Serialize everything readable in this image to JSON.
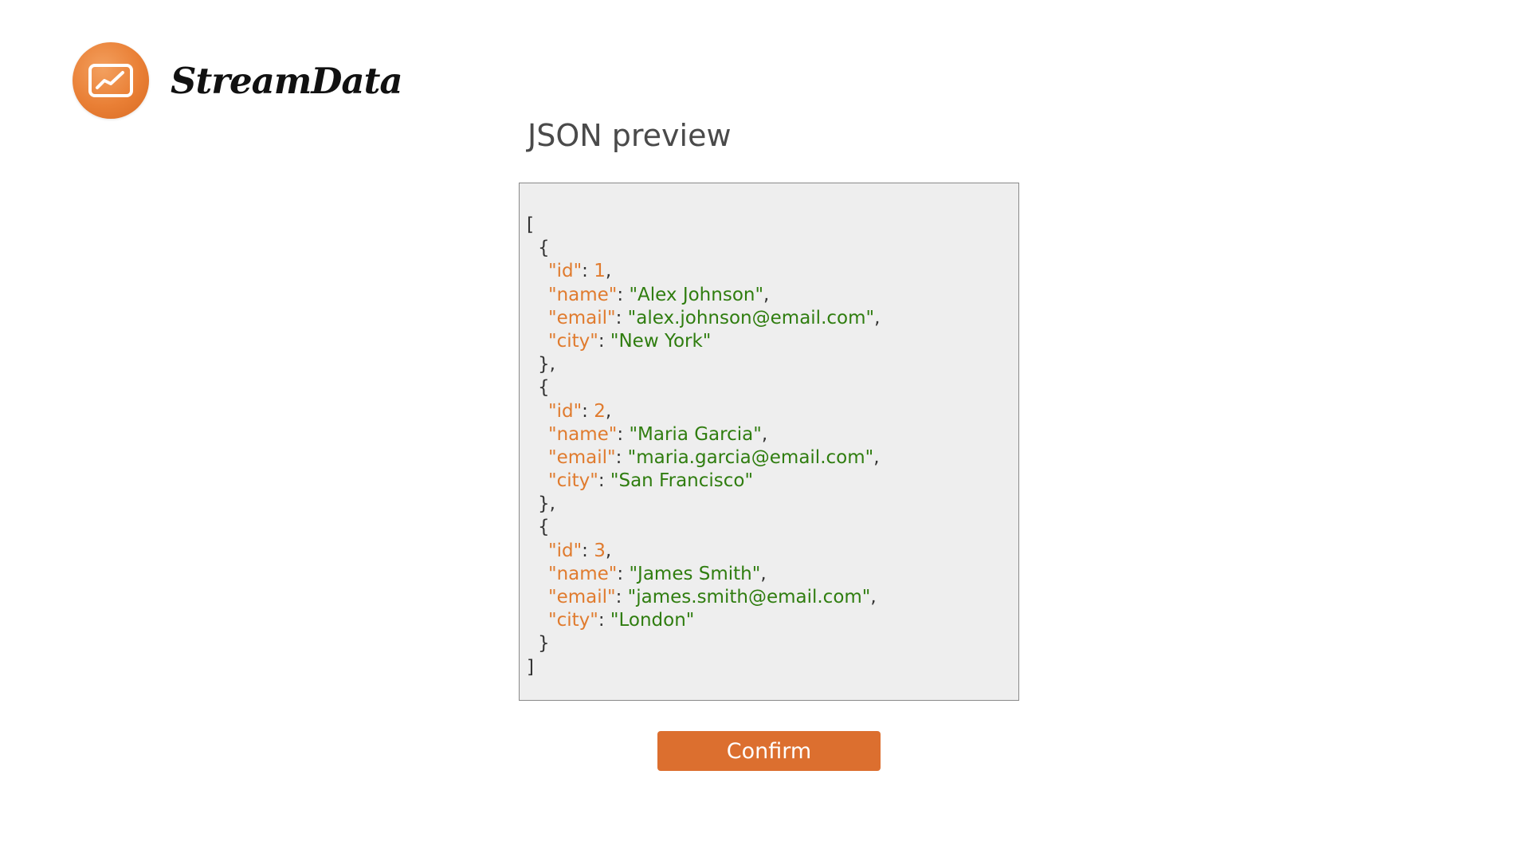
{
  "app": {
    "name": "StreamData",
    "logo_icon": "line-chart-icon",
    "accent_color": "#dc6f2f"
  },
  "page": {
    "title": "JSON preview"
  },
  "preview": {
    "open_bracket": "[",
    "close_bracket": "]",
    "records": [
      {
        "id": "1",
        "name": "\"Alex Johnson\"",
        "email": "\"alex.johnson@email.com\"",
        "city": "\"New York\""
      },
      {
        "id": "2",
        "name": "\"Maria Garcia\"",
        "email": "\"maria.garcia@email.com\"",
        "city": "\"San Francisco\""
      },
      {
        "id": "3",
        "name": "\"James Smith\"",
        "email": "\"james.smith@email.com\"",
        "city": "\"London\""
      }
    ],
    "key_labels": {
      "id": "\"id\"",
      "name": "\"name\"",
      "email": "\"email\"",
      "city": "\"city\""
    },
    "colors": {
      "key": "#e07b2e",
      "string": "#2f7d0f",
      "punctuation": "#333333"
    }
  },
  "actions": {
    "confirm_label": "Confirm"
  }
}
